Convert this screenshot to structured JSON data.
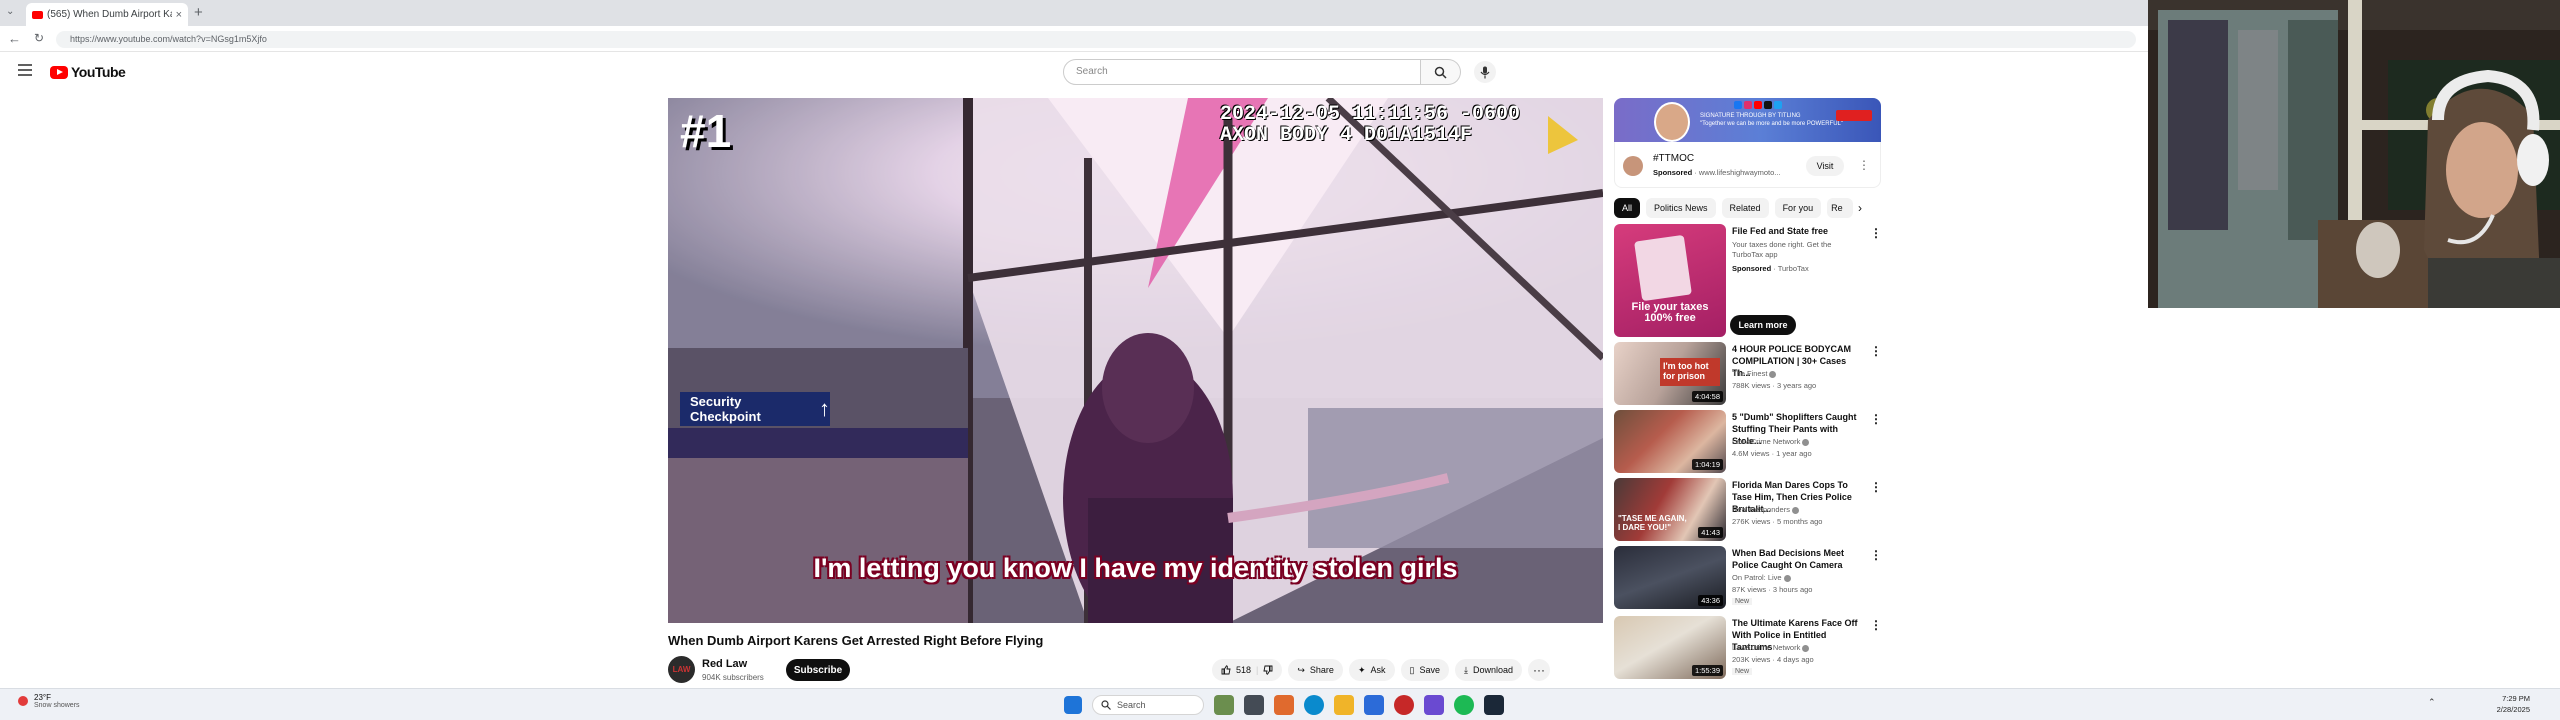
{
  "browser": {
    "tab_title": "(565) When Dumb Airport Ka",
    "tab_close": "×",
    "new_tab": "+",
    "address": "https://www.youtube.com/watch?v=NGsg1m5Xjfo"
  },
  "youtube": {
    "logo_text": "YouTube",
    "search_placeholder": "Search"
  },
  "video": {
    "overlay_rank": "#1",
    "bodycam_timestamp": "2024-12-05 11:11:56 -0600",
    "bodycam_device": "AXON BODY 4 D01A1514F",
    "sign_text": "Security Checkpoint",
    "caption": "I'm letting you know I have my identity stolen girls",
    "title": "When Dumb Airport Karens Get Arrested Right Before Flying",
    "channel_name": "Red Law",
    "channel_avatar_text": "LAW",
    "subscribers": "904K subscribers",
    "subscribe_label": "Subscribe",
    "like_count": "518",
    "share_label": "Share",
    "ask_label": "Ask",
    "save_label": "Save",
    "download_label": "Download",
    "more_label": "···"
  },
  "ad": {
    "banner_text_1": "SIGNATURE THROUGH BY TITLING",
    "banner_text_2": "\"Together we can be more and be more POWERFUL\"",
    "advertiser": "#TTMOC",
    "sponsored": "Sponsored",
    "domain": "· www.lifeshighwaymoto...",
    "visit_label": "Visit"
  },
  "chips": [
    "All",
    "Politics News",
    "Related",
    "For you",
    "Re"
  ],
  "sponsored_card": {
    "title": "File Fed and State free",
    "desc": "Your taxes done right. Get the TurboTax app",
    "sponsored": "Sponsored",
    "advertiser": "· TurboTax",
    "thumb_text": "File your taxes 100% free",
    "learn_more": "Learn more"
  },
  "recommendations": [
    {
      "title": "4 HOUR POLICE BODYCAM COMPILATION | 30+ Cases Th...",
      "channel": "The Finest",
      "meta": "788K views · 3 years ago",
      "duration": "4:04:58",
      "thumb_text": "I'm too hot for prison",
      "badge": ""
    },
    {
      "title": "5 \"Dumb\" Shoplifters Caught Stuffing Their Pants with Stole...",
      "channel": "Law&Crime Network",
      "meta": "4.6M views · 1 year ago",
      "duration": "1:04:19",
      "thumb_text": "",
      "badge": ""
    },
    {
      "title": "Florida Man Dares Cops To Tase Him, Then Cries Police Brutalit...",
      "channel": "Real Responders",
      "meta": "276K views · 5 months ago",
      "duration": "41:43",
      "thumb_text": "\"TASE ME AGAIN, I DARE YOU!\"",
      "badge": ""
    },
    {
      "title": "When Bad Decisions Meet Police Caught On Camera",
      "channel": "On Patrol: Live",
      "meta": "87K views · 3 hours ago",
      "duration": "43:36",
      "thumb_text": "",
      "badge": "New"
    },
    {
      "title": "The Ultimate Karens Face Off With Police in Entitled Tantrums",
      "channel": "Law&Crime Network",
      "meta": "203K views · 4 days ago",
      "duration": "1:55:39",
      "thumb_text": "",
      "badge": "New"
    }
  ],
  "taskbar": {
    "weather_temp": "23°F",
    "weather_desc": "Snow showers",
    "search_label": "Search",
    "time": "7:29 PM",
    "date": "2/28/2025"
  }
}
